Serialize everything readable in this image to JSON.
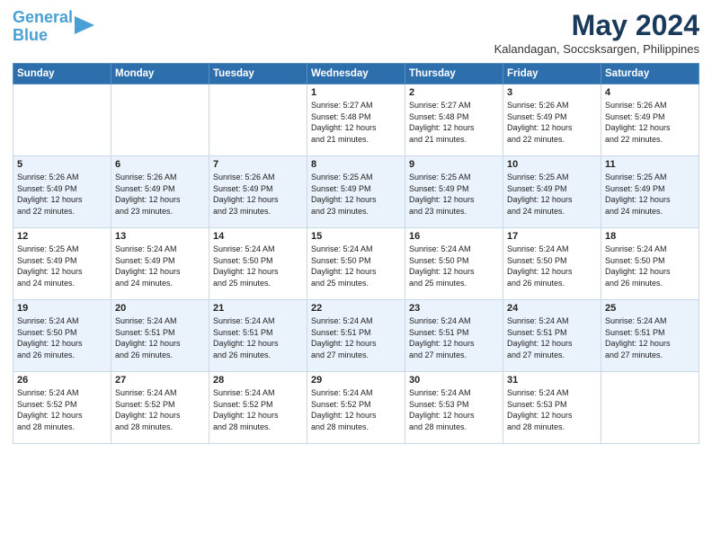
{
  "logo": {
    "line1": "General",
    "line2": "Blue"
  },
  "title": "May 2024",
  "location": "Kalandagan, Soccsksargen, Philippines",
  "days_of_week": [
    "Sunday",
    "Monday",
    "Tuesday",
    "Wednesday",
    "Thursday",
    "Friday",
    "Saturday"
  ],
  "weeks": [
    [
      {
        "day": "",
        "info": ""
      },
      {
        "day": "",
        "info": ""
      },
      {
        "day": "",
        "info": ""
      },
      {
        "day": "1",
        "info": "Sunrise: 5:27 AM\nSunset: 5:48 PM\nDaylight: 12 hours\nand 21 minutes."
      },
      {
        "day": "2",
        "info": "Sunrise: 5:27 AM\nSunset: 5:48 PM\nDaylight: 12 hours\nand 21 minutes."
      },
      {
        "day": "3",
        "info": "Sunrise: 5:26 AM\nSunset: 5:49 PM\nDaylight: 12 hours\nand 22 minutes."
      },
      {
        "day": "4",
        "info": "Sunrise: 5:26 AM\nSunset: 5:49 PM\nDaylight: 12 hours\nand 22 minutes."
      }
    ],
    [
      {
        "day": "5",
        "info": "Sunrise: 5:26 AM\nSunset: 5:49 PM\nDaylight: 12 hours\nand 22 minutes."
      },
      {
        "day": "6",
        "info": "Sunrise: 5:26 AM\nSunset: 5:49 PM\nDaylight: 12 hours\nand 23 minutes."
      },
      {
        "day": "7",
        "info": "Sunrise: 5:26 AM\nSunset: 5:49 PM\nDaylight: 12 hours\nand 23 minutes."
      },
      {
        "day": "8",
        "info": "Sunrise: 5:25 AM\nSunset: 5:49 PM\nDaylight: 12 hours\nand 23 minutes."
      },
      {
        "day": "9",
        "info": "Sunrise: 5:25 AM\nSunset: 5:49 PM\nDaylight: 12 hours\nand 23 minutes."
      },
      {
        "day": "10",
        "info": "Sunrise: 5:25 AM\nSunset: 5:49 PM\nDaylight: 12 hours\nand 24 minutes."
      },
      {
        "day": "11",
        "info": "Sunrise: 5:25 AM\nSunset: 5:49 PM\nDaylight: 12 hours\nand 24 minutes."
      }
    ],
    [
      {
        "day": "12",
        "info": "Sunrise: 5:25 AM\nSunset: 5:49 PM\nDaylight: 12 hours\nand 24 minutes."
      },
      {
        "day": "13",
        "info": "Sunrise: 5:24 AM\nSunset: 5:49 PM\nDaylight: 12 hours\nand 24 minutes."
      },
      {
        "day": "14",
        "info": "Sunrise: 5:24 AM\nSunset: 5:50 PM\nDaylight: 12 hours\nand 25 minutes."
      },
      {
        "day": "15",
        "info": "Sunrise: 5:24 AM\nSunset: 5:50 PM\nDaylight: 12 hours\nand 25 minutes."
      },
      {
        "day": "16",
        "info": "Sunrise: 5:24 AM\nSunset: 5:50 PM\nDaylight: 12 hours\nand 25 minutes."
      },
      {
        "day": "17",
        "info": "Sunrise: 5:24 AM\nSunset: 5:50 PM\nDaylight: 12 hours\nand 26 minutes."
      },
      {
        "day": "18",
        "info": "Sunrise: 5:24 AM\nSunset: 5:50 PM\nDaylight: 12 hours\nand 26 minutes."
      }
    ],
    [
      {
        "day": "19",
        "info": "Sunrise: 5:24 AM\nSunset: 5:50 PM\nDaylight: 12 hours\nand 26 minutes."
      },
      {
        "day": "20",
        "info": "Sunrise: 5:24 AM\nSunset: 5:51 PM\nDaylight: 12 hours\nand 26 minutes."
      },
      {
        "day": "21",
        "info": "Sunrise: 5:24 AM\nSunset: 5:51 PM\nDaylight: 12 hours\nand 26 minutes."
      },
      {
        "day": "22",
        "info": "Sunrise: 5:24 AM\nSunset: 5:51 PM\nDaylight: 12 hours\nand 27 minutes."
      },
      {
        "day": "23",
        "info": "Sunrise: 5:24 AM\nSunset: 5:51 PM\nDaylight: 12 hours\nand 27 minutes."
      },
      {
        "day": "24",
        "info": "Sunrise: 5:24 AM\nSunset: 5:51 PM\nDaylight: 12 hours\nand 27 minutes."
      },
      {
        "day": "25",
        "info": "Sunrise: 5:24 AM\nSunset: 5:51 PM\nDaylight: 12 hours\nand 27 minutes."
      }
    ],
    [
      {
        "day": "26",
        "info": "Sunrise: 5:24 AM\nSunset: 5:52 PM\nDaylight: 12 hours\nand 28 minutes."
      },
      {
        "day": "27",
        "info": "Sunrise: 5:24 AM\nSunset: 5:52 PM\nDaylight: 12 hours\nand 28 minutes."
      },
      {
        "day": "28",
        "info": "Sunrise: 5:24 AM\nSunset: 5:52 PM\nDaylight: 12 hours\nand 28 minutes."
      },
      {
        "day": "29",
        "info": "Sunrise: 5:24 AM\nSunset: 5:52 PM\nDaylight: 12 hours\nand 28 minutes."
      },
      {
        "day": "30",
        "info": "Sunrise: 5:24 AM\nSunset: 5:53 PM\nDaylight: 12 hours\nand 28 minutes."
      },
      {
        "day": "31",
        "info": "Sunrise: 5:24 AM\nSunset: 5:53 PM\nDaylight: 12 hours\nand 28 minutes."
      },
      {
        "day": "",
        "info": ""
      }
    ]
  ]
}
